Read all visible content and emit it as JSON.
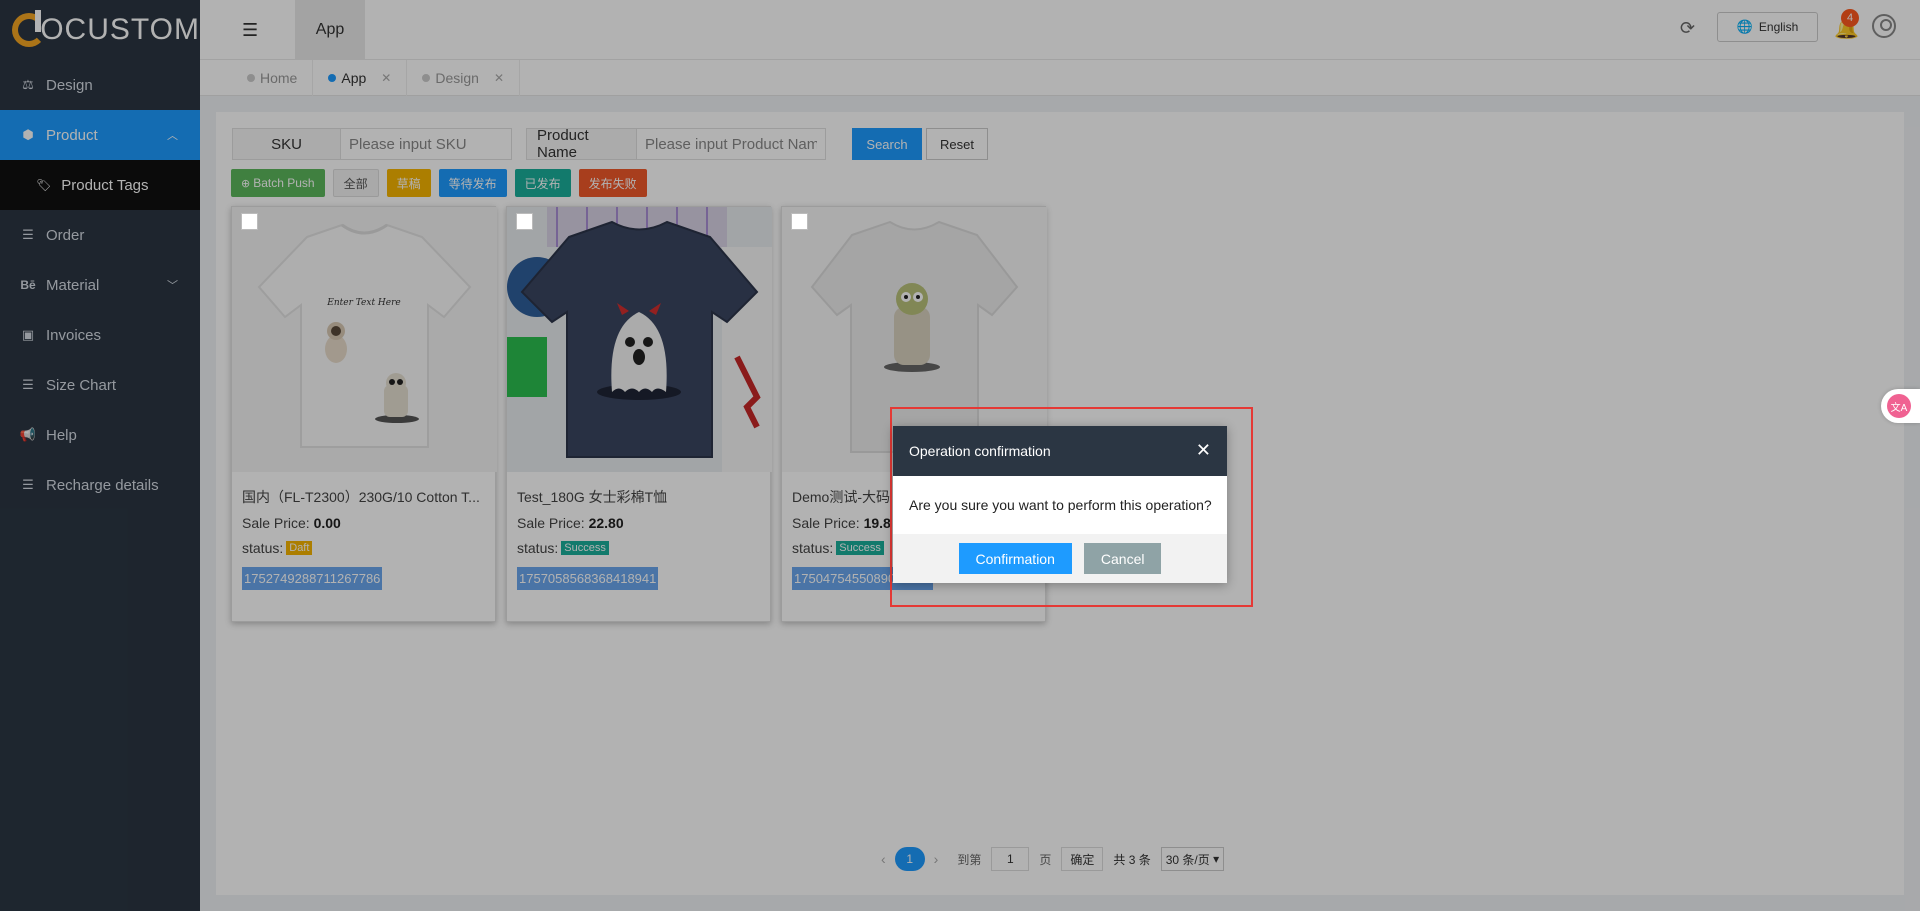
{
  "sidebar": {
    "logo_text": "OCUSTOM",
    "items": [
      {
        "label": "Design",
        "icon": "scale-icon"
      },
      {
        "label": "Product",
        "icon": "cube-icon",
        "active": true
      },
      {
        "label": "Product Tags",
        "icon": "tag-icon",
        "sub": true
      },
      {
        "label": "Order",
        "icon": "list-icon"
      },
      {
        "label": "Material",
        "icon": "behance-icon"
      },
      {
        "label": "Invoices",
        "icon": "id-card-icon"
      },
      {
        "label": "Size Chart",
        "icon": "list-icon"
      },
      {
        "label": "Help",
        "icon": "megaphone-icon"
      },
      {
        "label": "Recharge details",
        "icon": "list-icon"
      }
    ]
  },
  "header": {
    "app_tab": "App",
    "language": "English",
    "notification_count": "4"
  },
  "tabs": [
    {
      "label": "Home",
      "closable": false
    },
    {
      "label": "App",
      "closable": true,
      "active": true
    },
    {
      "label": "Design",
      "closable": true
    }
  ],
  "search": {
    "sku_label": "SKU",
    "sku_placeholder": "Please input SKU",
    "name_label": "Product Name",
    "name_placeholder": "Please input Product Name",
    "search_btn": "Search",
    "reset_btn": "Reset"
  },
  "filters": {
    "batch_push": "Batch Push",
    "all": "全部",
    "draft": "草稿",
    "pending": "等待发布",
    "published": "已发布",
    "failed": "发布失败"
  },
  "cards": [
    {
      "title": "国内（FL-T2300）230G/10 Cotton T...",
      "price_label": "Sale Price:",
      "price": "0.00",
      "status_label": "status:",
      "status": "Daft",
      "sku": "1752749288711267786"
    },
    {
      "title": "Test_180G 女士彩棉T恤",
      "price_label": "Sale Price:",
      "price": "22.80",
      "status_label": "status:",
      "status": "Success",
      "sku": "1757058568368418941"
    },
    {
      "title": "Demo测试-大码",
      "price_label": "Sale Price:",
      "price": "19.8",
      "status_label": "status:",
      "status": "Success",
      "sku": "1750475455089032785"
    }
  ],
  "pager": {
    "current": "1",
    "goto_label": "到第",
    "page_input": "1",
    "page_unit": "页",
    "confirm": "确定",
    "total": "共 3 条",
    "per_page": "30 条/页"
  },
  "modal": {
    "title": "Operation confirmation",
    "message": "Are you sure you want to perform this operation?",
    "confirm": "Confirmation",
    "cancel": "Cancel"
  },
  "colors": {
    "sidebar_bg": "#2b3643",
    "accent": "#1e9bff",
    "highlight": "#e53935"
  }
}
